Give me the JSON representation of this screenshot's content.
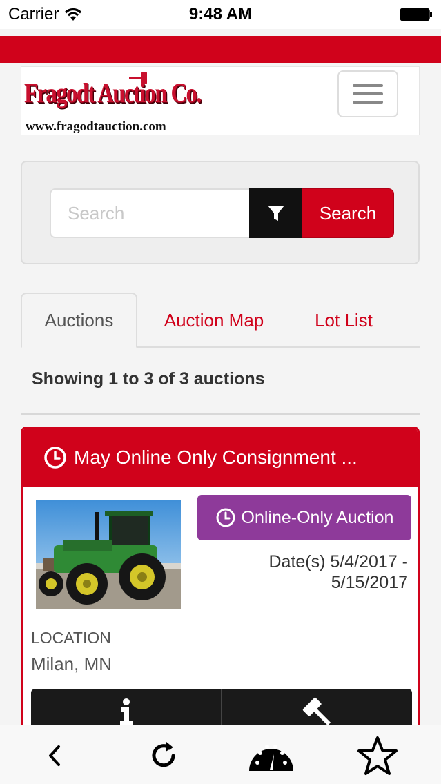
{
  "status_bar": {
    "carrier": "Carrier",
    "time": "9:48 AM"
  },
  "header": {
    "logo_text": "Fragodt Auction Co.",
    "logo_url": "www.fragodtauction.com"
  },
  "search": {
    "placeholder": "Search",
    "button_label": "Search",
    "filter_icon": "filter-icon"
  },
  "tabs": [
    {
      "label": "Auctions",
      "active": true
    },
    {
      "label": "Auction Map",
      "active": false
    },
    {
      "label": "Lot List",
      "active": false
    }
  ],
  "results": {
    "summary": "Showing 1 to 3 of 3 auctions"
  },
  "auctions": [
    {
      "title": "May Online Only Consignment ...",
      "type_badge": "Online-Only Auction",
      "dates_line1": "Date(s) 5/4/2017 -",
      "dates_line2": "5/15/2017",
      "location_label": "LOCATION",
      "location": "Milan, MN"
    }
  ],
  "toolbar": {
    "items": [
      "back-icon",
      "reload-icon",
      "dashboard-icon",
      "star-icon"
    ]
  },
  "colors": {
    "brand_red": "#d0021b",
    "online_purple": "#8e3a9a",
    "dark": "#111111"
  }
}
